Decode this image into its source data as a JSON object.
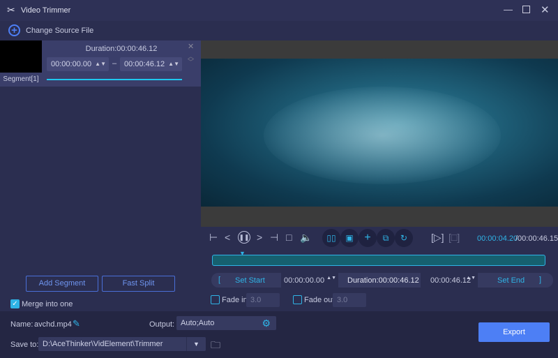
{
  "app": {
    "title": "Video Trimmer",
    "change_source": "Change Source File"
  },
  "segment": {
    "duration": "Duration:00:00:46.12",
    "start": "00:00:00.00",
    "end": "00:00:46.12",
    "label": "Segment[1]",
    "dash": "–"
  },
  "left_buttons": {
    "add_segment": "Add Segment",
    "fast_split": "Fast Split",
    "merge": "Merge into one",
    "merge_checked": true
  },
  "player": {
    "current_time": "00:00:04.20",
    "total_time": "/00:00:46.15",
    "progress_fraction": 0.09
  },
  "trim": {
    "set_start": "Set Start",
    "start": "00:00:00.00",
    "duration": "Duration:00:00:46.12",
    "end": "00:00:46.12",
    "set_end": "Set End"
  },
  "fade": {
    "fade_in": "Fade in",
    "fade_in_value": "3.0",
    "fade_out": "Fade out",
    "fade_out_value": "3.0"
  },
  "bottom": {
    "name_label": "Name:",
    "name": "avchd.mp4",
    "output_label": "Output:",
    "output": "Auto;Auto",
    "save_label": "Save to:",
    "save_path": "D:\\AceThinker\\VidElement\\Trimmer",
    "export": "Export"
  },
  "colors": {
    "accent": "#2fb4e6",
    "export": "#4d7ff5"
  }
}
